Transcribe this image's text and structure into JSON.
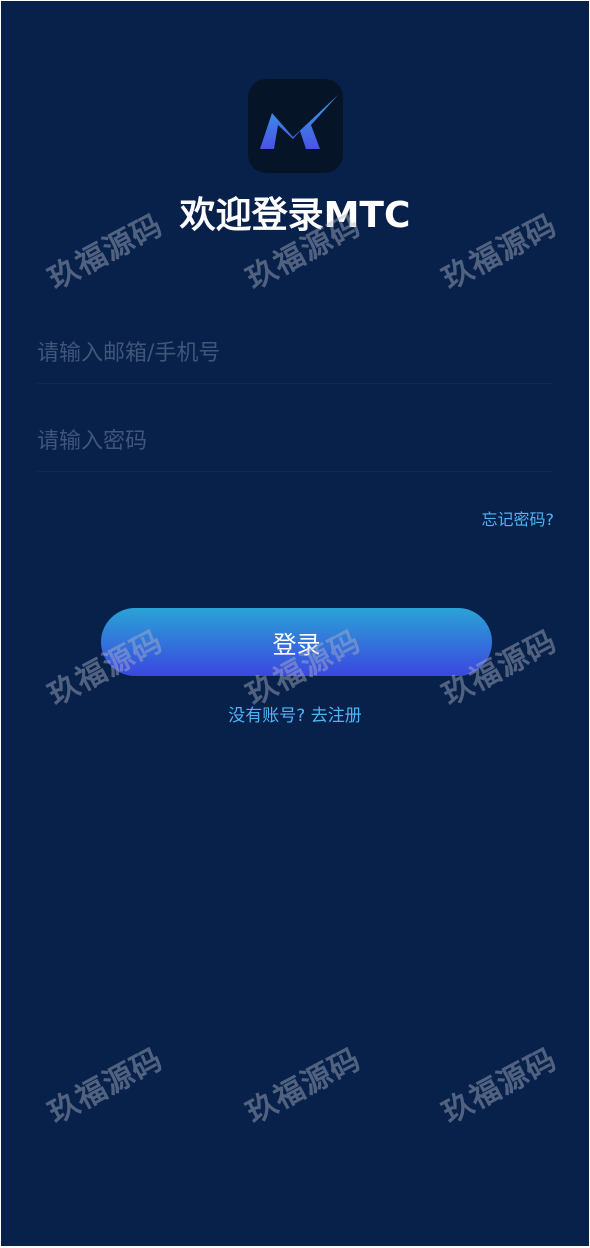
{
  "login": {
    "title": "欢迎登录MTC",
    "email_placeholder": "请输入邮箱/手机号",
    "password_placeholder": "请输入密码",
    "forgot_password": "忘记密码?",
    "login_button": "登录",
    "register_link": "没有账号? 去注册"
  },
  "logo": {
    "icon": "mtc-logo-icon",
    "colors": [
      "#33a7e8",
      "#4a52e6"
    ]
  },
  "watermark": {
    "text": "玖福源码"
  },
  "theme": {
    "background": "#08214a",
    "accent": "#4fb3f5",
    "button_gradient": [
      "#2aa3d6",
      "#3b47e0"
    ]
  }
}
